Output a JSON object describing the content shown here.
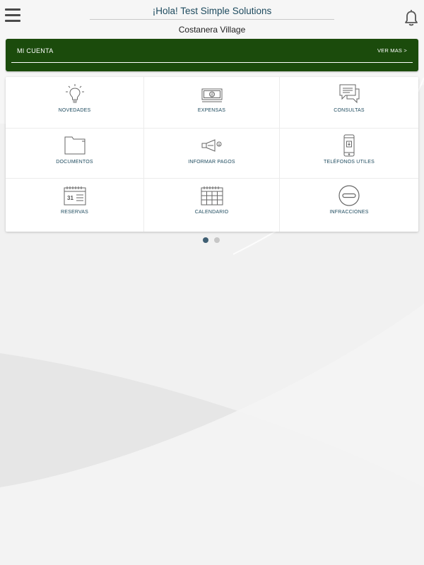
{
  "header": {
    "greeting": "¡Hola! Test Simple Solutions",
    "building": "Costanera Village",
    "menu_icon": "hamburger-menu-icon",
    "notification_icon": "bell-icon"
  },
  "account": {
    "title": "MI CUENTA",
    "more_label": "VER MAS >",
    "bar_color": "#1b4b0c"
  },
  "tiles": [
    {
      "label": "NOVEDADES",
      "icon": "lightbulb-icon"
    },
    {
      "label": "EXPENSAS",
      "icon": "banknote-icon"
    },
    {
      "label": "CONSULTAS",
      "icon": "chat-bubbles-icon"
    },
    {
      "label": "DOCUMENTOS",
      "icon": "folder-icon"
    },
    {
      "label": "INFORMAR PAGOS",
      "icon": "megaphone-icon"
    },
    {
      "label": "TELÉFONOS UTILES",
      "icon": "smartphone-icon"
    },
    {
      "label": "RESERVAS",
      "icon": "calendar-31-icon"
    },
    {
      "label": "CALENDARIO",
      "icon": "calendar-grid-icon"
    },
    {
      "label": "INFRACCIONES",
      "icon": "no-entry-icon"
    }
  ],
  "pager": {
    "pages": 2,
    "active_page": 1
  },
  "colors": {
    "accent_text": "#1d4a5e",
    "dot_active": "#3f5f73",
    "dot_inactive": "#c7c7c7"
  }
}
